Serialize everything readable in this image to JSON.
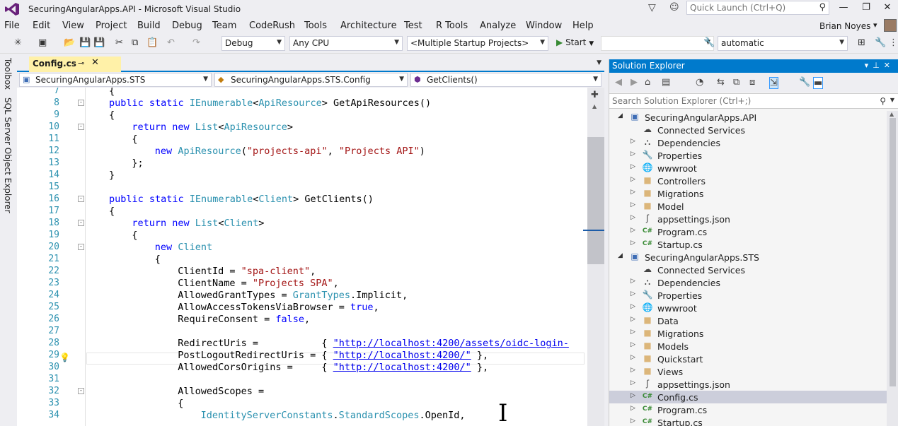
{
  "window": {
    "title": "SecuringAngularApps.API - Microsoft Visual Studio",
    "quick_launch_placeholder": "Quick Launch (Ctrl+Q)"
  },
  "menu": {
    "items": [
      "File",
      "Edit",
      "View",
      "Project",
      "Build",
      "Debug",
      "Team",
      "CodeRush",
      "Tools",
      "Architecture",
      "Test",
      "R Tools",
      "Analyze",
      "Window",
      "Help"
    ],
    "user_name": "Brian Noyes"
  },
  "toolbar": {
    "config": "Debug",
    "platform": "Any CPU",
    "startup": "<Multiple Startup Projects>",
    "start_label": "Start",
    "target": "automatic"
  },
  "side_tabs": {
    "toolbox": "Toolbox",
    "sql_explorer": "SQL Server Object Explorer"
  },
  "document_tab": {
    "label": "Config.cs"
  },
  "navbar": {
    "project": "SecuringAngularApps.STS",
    "class": "SecuringAngularApps.STS.Config",
    "member": "GetClients()"
  },
  "editor": {
    "lines": [
      {
        "n": "7",
        "collapse": "",
        "indent": 2,
        "tokens": [
          {
            "t": "{",
            "c": ""
          }
        ]
      },
      {
        "n": "8",
        "collapse": "-",
        "indent": 2,
        "tokens": [
          {
            "t": "public static ",
            "c": "kw"
          },
          {
            "t": "IEnumerable",
            "c": "ty"
          },
          {
            "t": "<",
            "c": ""
          },
          {
            "t": "ApiResource",
            "c": "ty"
          },
          {
            "t": "> GetApiResources()",
            "c": ""
          }
        ]
      },
      {
        "n": "9",
        "collapse": "",
        "indent": 2,
        "tokens": [
          {
            "t": "{",
            "c": ""
          }
        ]
      },
      {
        "n": "10",
        "collapse": "-",
        "indent": 3,
        "tokens": [
          {
            "t": "return new ",
            "c": "kw"
          },
          {
            "t": "List",
            "c": "ty"
          },
          {
            "t": "<",
            "c": ""
          },
          {
            "t": "ApiResource",
            "c": "ty"
          },
          {
            "t": ">",
            "c": ""
          }
        ]
      },
      {
        "n": "11",
        "collapse": "",
        "indent": 3,
        "tokens": [
          {
            "t": "{",
            "c": ""
          }
        ]
      },
      {
        "n": "12",
        "collapse": "",
        "indent": 4,
        "tokens": [
          {
            "t": "new ",
            "c": "kw"
          },
          {
            "t": "ApiResource",
            "c": "ty"
          },
          {
            "t": "(",
            "c": ""
          },
          {
            "t": "\"projects-api\"",
            "c": "st"
          },
          {
            "t": ", ",
            "c": ""
          },
          {
            "t": "\"Projects API\"",
            "c": "st"
          },
          {
            "t": ")",
            "c": ""
          }
        ]
      },
      {
        "n": "13",
        "collapse": "",
        "indent": 3,
        "tokens": [
          {
            "t": "};",
            "c": ""
          }
        ]
      },
      {
        "n": "14",
        "collapse": "",
        "indent": 2,
        "tokens": [
          {
            "t": "}",
            "c": ""
          }
        ]
      },
      {
        "n": "15",
        "collapse": "",
        "indent": 0,
        "tokens": []
      },
      {
        "n": "16",
        "collapse": "-",
        "indent": 2,
        "tokens": [
          {
            "t": "public static ",
            "c": "kw"
          },
          {
            "t": "IEnumerable",
            "c": "ty"
          },
          {
            "t": "<",
            "c": ""
          },
          {
            "t": "Client",
            "c": "ty"
          },
          {
            "t": "> GetClients()",
            "c": ""
          }
        ]
      },
      {
        "n": "17",
        "collapse": "",
        "indent": 2,
        "tokens": [
          {
            "t": "{",
            "c": ""
          }
        ]
      },
      {
        "n": "18",
        "collapse": "-",
        "indent": 3,
        "tokens": [
          {
            "t": "return new ",
            "c": "kw"
          },
          {
            "t": "List",
            "c": "ty"
          },
          {
            "t": "<",
            "c": ""
          },
          {
            "t": "Client",
            "c": "ty"
          },
          {
            "t": ">",
            "c": ""
          }
        ]
      },
      {
        "n": "19",
        "collapse": "",
        "indent": 3,
        "tokens": [
          {
            "t": "{",
            "c": ""
          }
        ]
      },
      {
        "n": "20",
        "collapse": "-",
        "indent": 4,
        "tokens": [
          {
            "t": "new ",
            "c": "kw"
          },
          {
            "t": "Client",
            "c": "ty"
          }
        ]
      },
      {
        "n": "21",
        "collapse": "",
        "indent": 4,
        "tokens": [
          {
            "t": "{",
            "c": ""
          }
        ]
      },
      {
        "n": "22",
        "collapse": "",
        "indent": 5,
        "tokens": [
          {
            "t": "ClientId = ",
            "c": ""
          },
          {
            "t": "\"spa-client\"",
            "c": "st"
          },
          {
            "t": ",",
            "c": ""
          }
        ]
      },
      {
        "n": "23",
        "collapse": "",
        "indent": 5,
        "tokens": [
          {
            "t": "ClientName = ",
            "c": ""
          },
          {
            "t": "\"Projects SPA\"",
            "c": "st"
          },
          {
            "t": ",",
            "c": ""
          }
        ]
      },
      {
        "n": "24",
        "collapse": "",
        "indent": 5,
        "tokens": [
          {
            "t": "AllowedGrantTypes = ",
            "c": ""
          },
          {
            "t": "GrantTypes",
            "c": "ty"
          },
          {
            "t": ".Implicit,",
            "c": ""
          }
        ]
      },
      {
        "n": "25",
        "collapse": "",
        "indent": 5,
        "tokens": [
          {
            "t": "AllowAccessTokensViaBrowser = ",
            "c": ""
          },
          {
            "t": "true",
            "c": "kw"
          },
          {
            "t": ",",
            "c": ""
          }
        ]
      },
      {
        "n": "26",
        "collapse": "",
        "indent": 5,
        "tokens": [
          {
            "t": "RequireConsent = ",
            "c": ""
          },
          {
            "t": "false",
            "c": "kw"
          },
          {
            "t": ",",
            "c": ""
          }
        ]
      },
      {
        "n": "27",
        "collapse": "",
        "indent": 0,
        "tokens": []
      },
      {
        "n": "28",
        "collapse": "",
        "indent": 5,
        "tokens": [
          {
            "t": "RedirectUris =           { ",
            "c": ""
          },
          {
            "t": "\"http://localhost:4200/assets/oidc-login-",
            "c": "st url"
          }
        ]
      },
      {
        "n": "29",
        "collapse": "",
        "indent": 5,
        "tokens": [
          {
            "t": "PostLogoutRedirectUris = { ",
            "c": ""
          },
          {
            "t": "\"http://localhost:4200/\"",
            "c": "st url"
          },
          {
            "t": " },",
            "c": ""
          }
        ]
      },
      {
        "n": "30",
        "collapse": "",
        "indent": 5,
        "tokens": [
          {
            "t": "AllowedCorsOrigins =     { ",
            "c": ""
          },
          {
            "t": "\"http://localhost:4200/\"",
            "c": "st url"
          },
          {
            "t": " },",
            "c": ""
          }
        ]
      },
      {
        "n": "31",
        "collapse": "",
        "indent": 0,
        "tokens": []
      },
      {
        "n": "32",
        "collapse": "-",
        "indent": 5,
        "tokens": [
          {
            "t": "AllowedScopes =",
            "c": ""
          }
        ]
      },
      {
        "n": "33",
        "collapse": "",
        "indent": 5,
        "tokens": [
          {
            "t": "{",
            "c": ""
          }
        ]
      },
      {
        "n": "34",
        "collapse": "",
        "indent": 6,
        "tokens": [
          {
            "t": "IdentityServerConstants",
            "c": "ty"
          },
          {
            "t": ".",
            "c": ""
          },
          {
            "t": "StandardScopes",
            "c": "ty"
          },
          {
            "t": ".OpenId,",
            "c": ""
          }
        ]
      }
    ]
  },
  "solution_explorer": {
    "title": "Solution Explorer",
    "search_placeholder": "Search Solution Explorer (Ctrl+;)",
    "items": [
      {
        "label": "SecuringAngularApps.API",
        "level": 0,
        "expander": "expanded",
        "icon": "project-icon",
        "selected": false
      },
      {
        "label": "Connected Services",
        "level": 1,
        "expander": "none",
        "icon": "connected-services-icon",
        "selected": false
      },
      {
        "label": "Dependencies",
        "level": 1,
        "expander": "collapsed",
        "icon": "dependencies-icon",
        "selected": false
      },
      {
        "label": "Properties",
        "level": 1,
        "expander": "collapsed",
        "icon": "wrench-icon",
        "selected": false
      },
      {
        "label": "wwwroot",
        "level": 1,
        "expander": "collapsed",
        "icon": "globe-icon",
        "selected": false
      },
      {
        "label": "Controllers",
        "level": 1,
        "expander": "collapsed",
        "icon": "folder-icon",
        "selected": false
      },
      {
        "label": "Migrations",
        "level": 1,
        "expander": "collapsed",
        "icon": "folder-icon",
        "selected": false
      },
      {
        "label": "Model",
        "level": 1,
        "expander": "collapsed",
        "icon": "folder-icon",
        "selected": false
      },
      {
        "label": "appsettings.json",
        "level": 1,
        "expander": "collapsed",
        "icon": "json-file-icon",
        "selected": false
      },
      {
        "label": "Program.cs",
        "level": 1,
        "expander": "collapsed",
        "icon": "csharp-file-icon",
        "selected": false
      },
      {
        "label": "Startup.cs",
        "level": 1,
        "expander": "collapsed",
        "icon": "csharp-file-icon",
        "selected": false
      },
      {
        "label": "SecuringAngularApps.STS",
        "level": 0,
        "expander": "expanded",
        "icon": "project-icon",
        "selected": false
      },
      {
        "label": "Connected Services",
        "level": 1,
        "expander": "none",
        "icon": "connected-services-icon",
        "selected": false
      },
      {
        "label": "Dependencies",
        "level": 1,
        "expander": "collapsed",
        "icon": "dependencies-icon",
        "selected": false
      },
      {
        "label": "Properties",
        "level": 1,
        "expander": "collapsed",
        "icon": "wrench-icon",
        "selected": false
      },
      {
        "label": "wwwroot",
        "level": 1,
        "expander": "collapsed",
        "icon": "globe-icon",
        "selected": false
      },
      {
        "label": "Data",
        "level": 1,
        "expander": "collapsed",
        "icon": "folder-icon",
        "selected": false
      },
      {
        "label": "Migrations",
        "level": 1,
        "expander": "collapsed",
        "icon": "folder-icon",
        "selected": false
      },
      {
        "label": "Models",
        "level": 1,
        "expander": "collapsed",
        "icon": "folder-icon",
        "selected": false
      },
      {
        "label": "Quickstart",
        "level": 1,
        "expander": "collapsed",
        "icon": "folder-icon",
        "selected": false
      },
      {
        "label": "Views",
        "level": 1,
        "expander": "collapsed",
        "icon": "folder-icon",
        "selected": false
      },
      {
        "label": "appsettings.json",
        "level": 1,
        "expander": "collapsed",
        "icon": "json-file-icon",
        "selected": false
      },
      {
        "label": "Config.cs",
        "level": 1,
        "expander": "collapsed",
        "icon": "csharp-file-icon",
        "selected": true
      },
      {
        "label": "Program.cs",
        "level": 1,
        "expander": "collapsed",
        "icon": "csharp-file-icon",
        "selected": false
      },
      {
        "label": "Startup.cs",
        "level": 1,
        "expander": "collapsed",
        "icon": "csharp-file-icon",
        "selected": false
      }
    ]
  },
  "colors": {
    "accent": "#007acc",
    "keyword": "#0000ff",
    "type": "#2b91af",
    "string": "#a31515",
    "tab_active": "#fff1a8",
    "selection": "#cccedb"
  }
}
